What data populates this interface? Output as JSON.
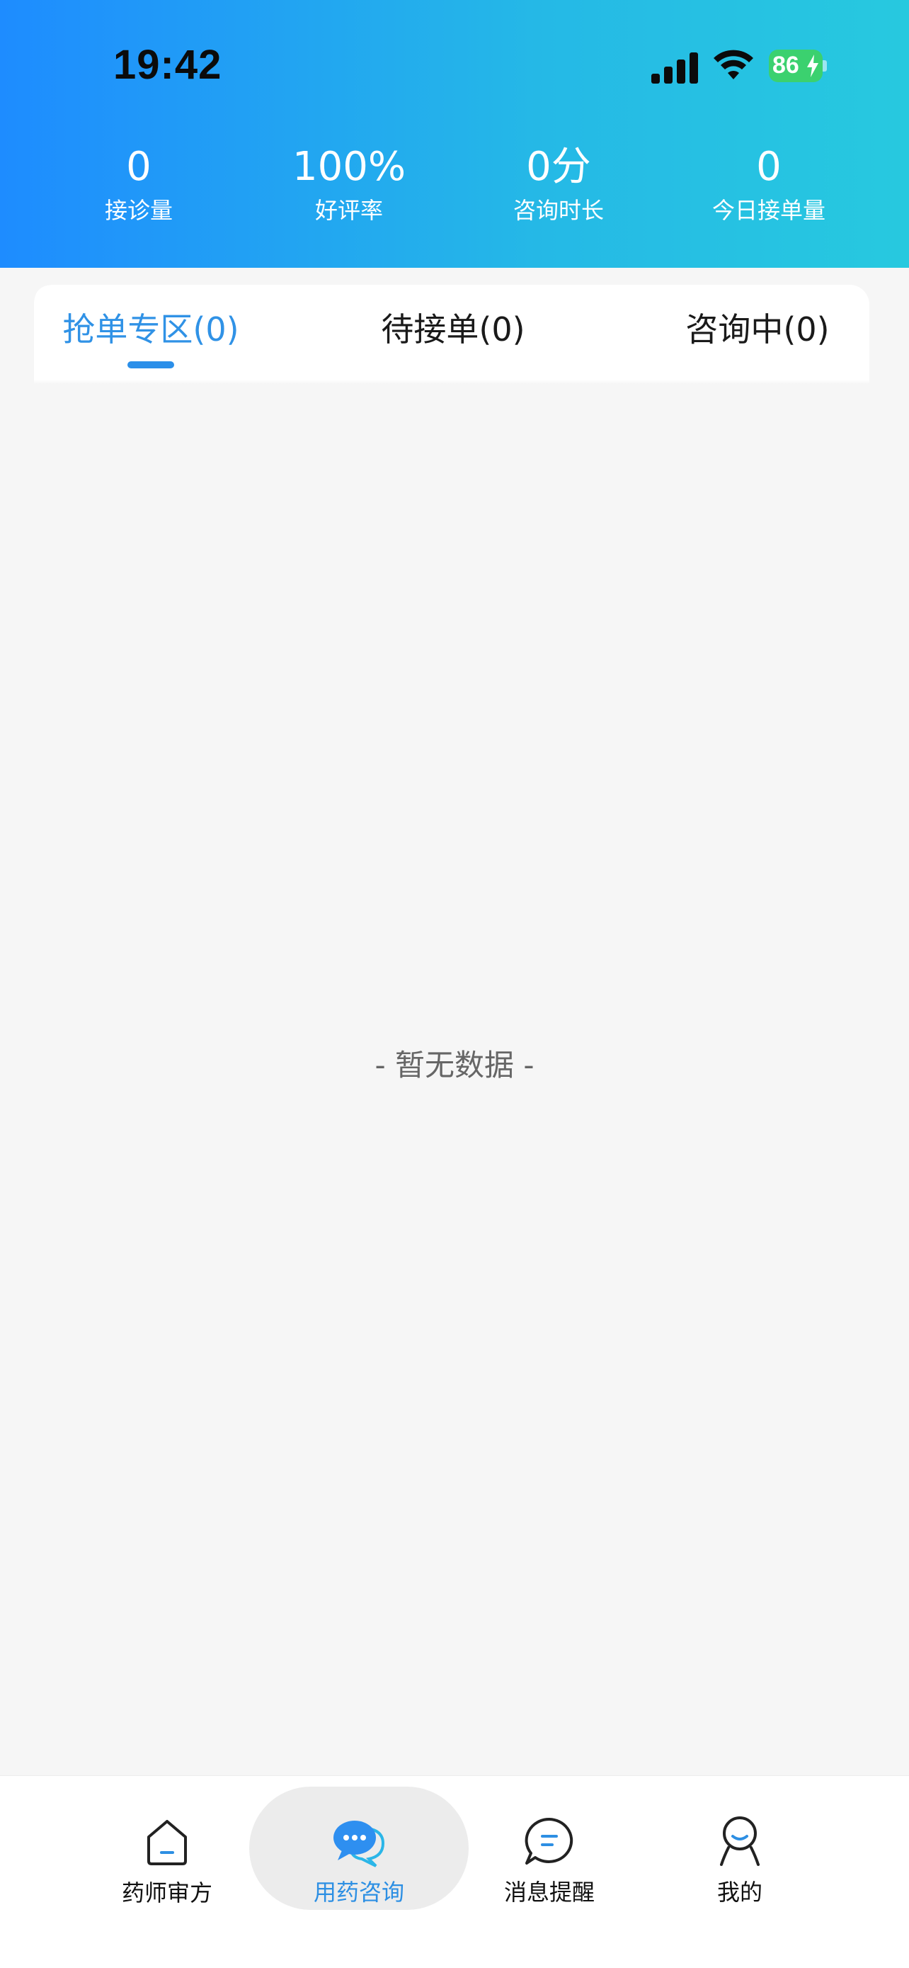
{
  "status_bar": {
    "time": "19:42",
    "battery": "86"
  },
  "stats": [
    {
      "value": "0",
      "label": "接诊量"
    },
    {
      "value": "100%",
      "label": "好评率"
    },
    {
      "value": "0分",
      "label": "咨询时长"
    },
    {
      "value": "0",
      "label": "今日接单量"
    }
  ],
  "tabs": [
    {
      "label": "抢单专区(0)",
      "active": true
    },
    {
      "label": "待接单(0)",
      "active": false
    },
    {
      "label": "咨询中(0)",
      "active": false
    }
  ],
  "empty_state": "- 暂无数据 -",
  "bottom_nav": [
    {
      "label": "药师审方",
      "icon": "home-icon",
      "active": false
    },
    {
      "label": "用药咨询",
      "icon": "chat-bubbles-icon",
      "active": true
    },
    {
      "label": "消息提醒",
      "icon": "message-icon",
      "active": false
    },
    {
      "label": "我的",
      "icon": "person-icon",
      "active": false
    }
  ],
  "colors": {
    "header_start": "#1e8cff",
    "header_end": "#27c9df",
    "accent": "#2d8fe3",
    "battery": "#3bd16f"
  }
}
